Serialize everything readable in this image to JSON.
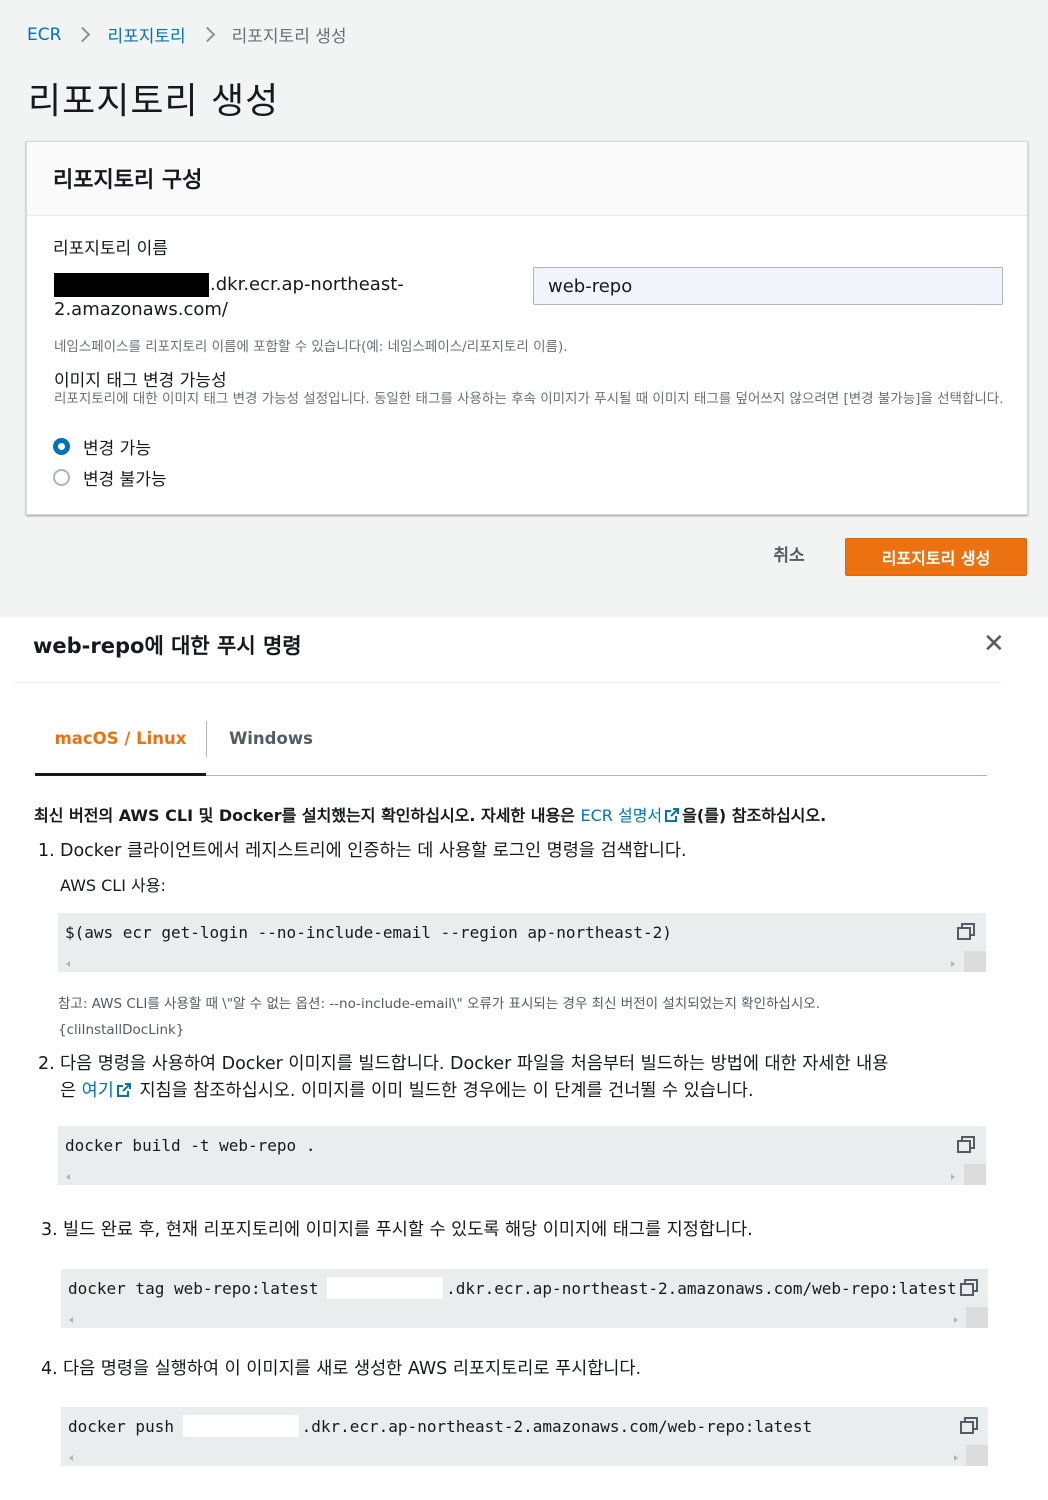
{
  "breadcrumb": {
    "items": [
      "ECR",
      "리포지토리",
      "리포지토리 생성"
    ]
  },
  "page_title": "리포지토리 생성",
  "panel": {
    "title": "리포지토리 구성",
    "repo_name_label": "리포지토리 이름",
    "uri_suffix_line1": ".dkr.ecr.ap-northeast-",
    "uri_suffix_line2": "2.amazonaws.com/",
    "repo_name_value": "web-repo",
    "namespace_hint": "네임스페이스를 리포지토리 이름에 포함할 수 있습니다(예: 네임스페이스/리포지토리 이름).",
    "tag_mutability_label": "이미지 태그 변경 가능성",
    "tag_mutability_desc": "리포지토리에 대한 이미지 태그 변경 가능성 설정입니다. 동일한 태그를 사용하는 후속 이미지가 푸시될 때 이미지 태그를 덮어쓰지 않으려면 [변경 불가능]을 선택합니다.",
    "options": [
      {
        "label": "변경 가능",
        "checked": true
      },
      {
        "label": "변경 불가능",
        "checked": false
      }
    ]
  },
  "actions": {
    "cancel": "취소",
    "create": "리포지토리 생성"
  },
  "modal": {
    "title": "web-repo에 대한 푸시 명령",
    "tabs": [
      "macOS / Linux",
      "Windows"
    ],
    "intro_before": "최신 버전의 AWS CLI 및 Docker를 설치했는지 확인하십시오. 자세한 내용은 ",
    "intro_link": "ECR 설명서",
    "intro_after": "을(를) 참조하십시오.",
    "step1": "Docker 클라이언트에서 레지스트리에 인증하는 데 사용할 로그인 명령을 검색합니다.",
    "aws_cli_label": "AWS CLI 사용:",
    "cmd1": "$(aws ecr get-login --no-include-email --region ap-northeast-2)",
    "note_line1": "참고: AWS CLI를 사용할 때 \\\"알 수 없는 옵션: --no-include-email\\\" 오류가 표시되는 경우 최신 버전이 설치되었는지 확인하십시오.",
    "note_line2": "{cliInstallDocLink}",
    "step2_line1": "다음 명령을 사용하여 Docker 이미지를 빌드합니다. Docker 파일을 처음부터 빌드하는 방법에 대한 자세한 내용",
    "step2_prefix": "은 ",
    "step2_link": "여기",
    "step2_suffix": " 지침을 참조하십시오. 이미지를 이미 빌드한 경우에는 이 단계를 건너뛸 수 있습니다.",
    "cmd2": "docker build -t web-repo .",
    "step3": "빌드 완료 후, 현재 리포지토리에 이미지를 푸시할 수 있도록 해당 이미지에 태그를 지정합니다.",
    "cmd3_prefix": "docker tag web-repo:latest ",
    "cmd3_suffix": ".dkr.ecr.ap-northeast-2.amazonaws.com/web-repo:latest",
    "step4": "다음 명령을 실행하여 이 이미지를 새로 생성한 AWS 리포지토리로 푸시합니다.",
    "cmd4_prefix": "docker push ",
    "cmd4_suffix": ".dkr.ecr.ap-northeast-2.amazonaws.com/web-repo:latest",
    "step_numbers": [
      "1.",
      "2.",
      "3.",
      "4."
    ]
  },
  "icons": [
    "chevron-right-icon",
    "close-icon",
    "external-link-icon",
    "copy-icon"
  ],
  "colors": {
    "link": "#0073bb",
    "primary": "#ec7211",
    "text": "#16191f",
    "muted": "#687078",
    "code_bg": "#eaeded"
  }
}
